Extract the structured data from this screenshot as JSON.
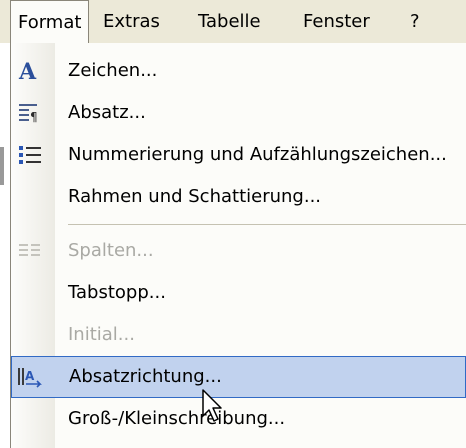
{
  "menubar": {
    "items": [
      {
        "label": "Format",
        "state": "open"
      },
      {
        "label": "Extras"
      },
      {
        "label": "Tabelle"
      },
      {
        "label": "Fenster"
      },
      {
        "label": "?"
      }
    ]
  },
  "menu": {
    "items": [
      {
        "label": "Zeichen...",
        "icon": "character-a-icon",
        "enabled": true
      },
      {
        "label": "Absatz...",
        "icon": "paragraph-icon",
        "enabled": true
      },
      {
        "label": "Nummerierung und Aufzählungszeichen...",
        "icon": "bullets-list-icon",
        "enabled": true
      },
      {
        "label": "Rahmen und Schattierung...",
        "icon": null,
        "enabled": true
      },
      {
        "label": "Spalten...",
        "icon": "columns-icon",
        "enabled": false
      },
      {
        "label": "Tabstopp...",
        "icon": null,
        "enabled": true
      },
      {
        "label": "Initial...",
        "icon": null,
        "enabled": false
      },
      {
        "label": "Absatzrichtung...",
        "icon": "paragraph-direction-icon",
        "enabled": true,
        "highlighted": true
      },
      {
        "label": "Groß-/Kleinschreibung...",
        "icon": null,
        "enabled": true
      }
    ]
  },
  "colors": {
    "menubar_bg": "#ece9d8",
    "highlight_bg": "#c1d2ee",
    "highlight_border": "#316ac5",
    "disabled_text": "#a9a9a4"
  }
}
